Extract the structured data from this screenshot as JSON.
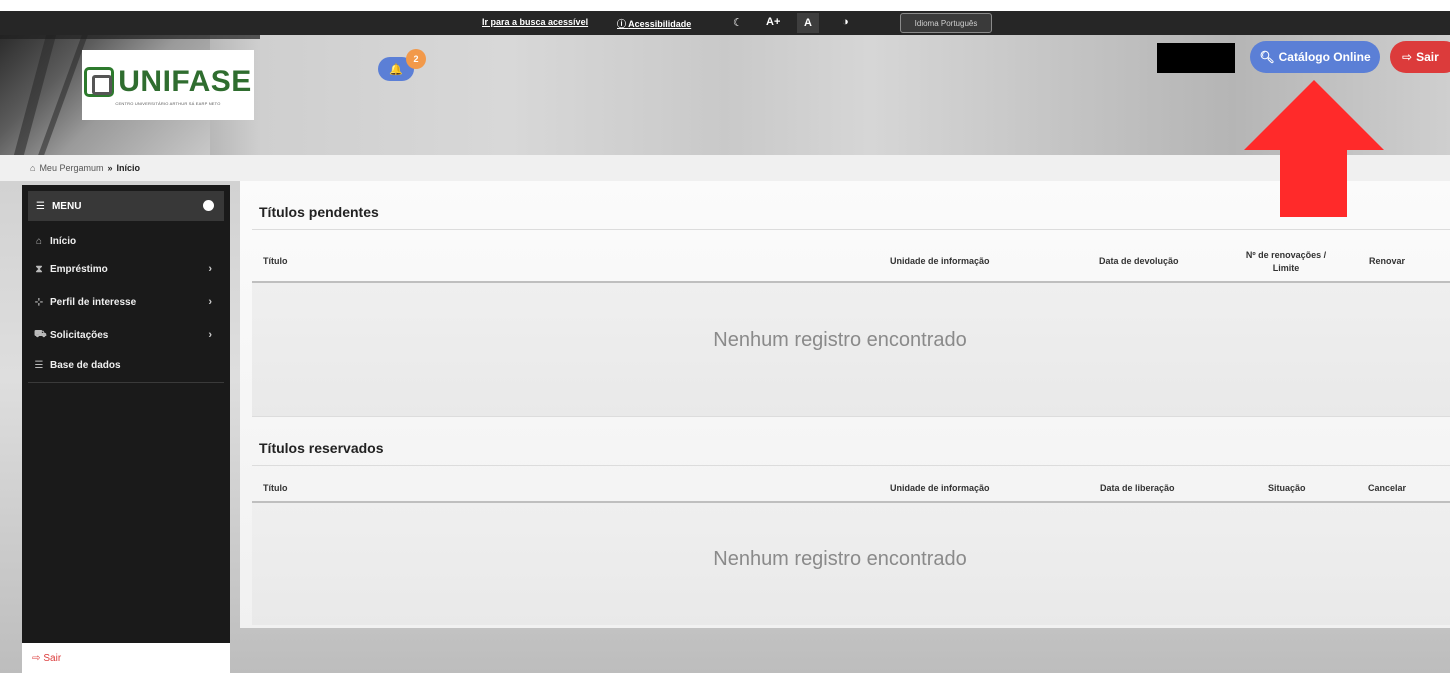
{
  "accessibility_bar": {
    "skip_link": "Ir para a busca acessível",
    "accessibility_label": "Acessibilidade",
    "font_increase": "A+",
    "font_normal": "A",
    "language_button": "Idioma Português"
  },
  "header": {
    "logo": {
      "name": "UNIFASE",
      "tagline": "CENTRO UNIVERSITÁRIO ARTHUR SÁ EARP NETO"
    },
    "notification_count": "2",
    "catalog_button": "Catálogo Online",
    "logout_button": "Sair"
  },
  "breadcrumb": {
    "root": "Meu Pergamum",
    "separator": "»",
    "current": "Início"
  },
  "sidebar": {
    "menu_title": "MENU",
    "items": [
      {
        "label": "Início",
        "icon": "home-icon",
        "has_submenu": false
      },
      {
        "label": "Empréstimo",
        "icon": "hourglass-icon",
        "has_submenu": true
      },
      {
        "label": "Perfil de interesse",
        "icon": "sitemap-icon",
        "has_submenu": true
      },
      {
        "label": "Solicitações",
        "icon": "cart-icon",
        "has_submenu": true
      },
      {
        "label": "Base de dados",
        "icon": "database-icon",
        "has_submenu": false
      }
    ],
    "logout": "Sair"
  },
  "pending": {
    "title": "Títulos pendentes",
    "columns": [
      "Título",
      "Unidade de informação",
      "Data de devolução",
      "Nº de renovações / Limite",
      "Renovar"
    ],
    "empty_message": "Nenhum registro encontrado"
  },
  "reserved": {
    "title": "Títulos reservados",
    "columns": [
      "Título",
      "Unidade de informação",
      "Data de liberação",
      "Situação",
      "Cancelar"
    ],
    "empty_message": "Nenhum registro encontrado"
  },
  "colors": {
    "catalog_button": "#5b7fd6",
    "logout_button": "#dc3b3b",
    "badge": "#f2994a",
    "annotation_arrow": "#ff2a2a",
    "sidebar_bg": "#1a1a1a"
  }
}
